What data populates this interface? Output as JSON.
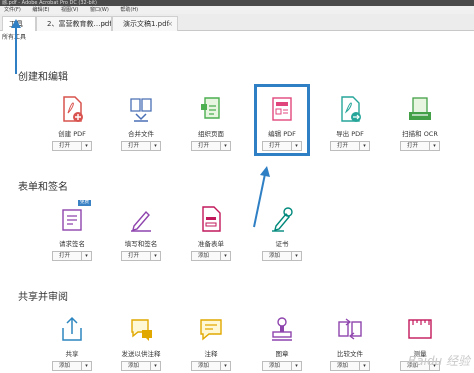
{
  "window": {
    "title": "融.pdf - Adobe Acrobat Pro DC (32-bit)"
  },
  "menu": [
    "文件(F)",
    "编辑(E)",
    "视图(V)",
    "窗口(W)",
    "帮助(H)"
  ],
  "tabs": [
    {
      "label": "工具"
    },
    {
      "label": "2、富营教育教…pdf"
    },
    {
      "label": "演示文稿1.pdf"
    }
  ],
  "subbar": {
    "label": "所有工具"
  },
  "sections": [
    {
      "title": "创建和编辑"
    },
    {
      "title": "表单和签名"
    },
    {
      "title": "共享并审阅"
    }
  ],
  "tools": {
    "create_pdf": {
      "label": "创建 PDF",
      "button": "打开"
    },
    "combine": {
      "label": "合并文件",
      "button": "打开"
    },
    "organize": {
      "label": "组织页面",
      "button": "打开"
    },
    "edit_pdf": {
      "label": "编辑 PDF",
      "button": "打开"
    },
    "export_pdf": {
      "label": "导出 PDF",
      "button": "打开"
    },
    "scan_ocr": {
      "label": "扫描和 OCR",
      "button": "打开"
    },
    "request_sign": {
      "label": "请求签名",
      "button": "打开",
      "badge": "免费"
    },
    "fill_sign": {
      "label": "填写和签名",
      "button": "打开"
    },
    "prepare_form": {
      "label": "准备表单",
      "button": "添加"
    },
    "certificates": {
      "label": "证书",
      "button": "添加"
    },
    "share": {
      "label": "共享",
      "button": "添加"
    },
    "send_comment": {
      "label": "发送以供注释",
      "button": "添加"
    },
    "comment": {
      "label": "注释",
      "button": "添加"
    },
    "stamp": {
      "label": "图章",
      "button": "添加"
    },
    "compare": {
      "label": "比较文件",
      "button": "添加"
    },
    "measure": {
      "label": "测量",
      "button": "添加"
    }
  },
  "dropdown_glyph": "▾",
  "close_glyph": "×",
  "watermark": "Baidu 经验",
  "colors": {
    "highlight": "#2f7fc4",
    "arrow": "#2f7fc4"
  }
}
